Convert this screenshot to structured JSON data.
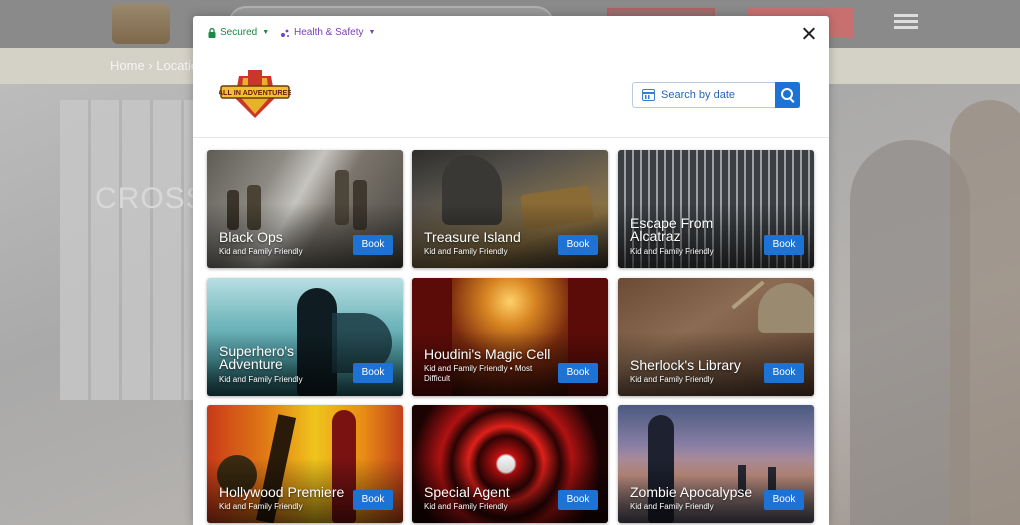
{
  "background": {
    "breadcrumb": "Home › Locatio",
    "hero_text": "CROSS"
  },
  "modal": {
    "secured_label": "Secured",
    "health_label": "Health & Safety",
    "search": {
      "placeholder": "Search by date"
    },
    "brand": {
      "logo_text": "ALL IN ADVENTURES"
    },
    "book_label": "Book",
    "rooms": [
      {
        "title": "Black Ops",
        "subtitle": "Kid and Family Friendly"
      },
      {
        "title": "Treasure Island",
        "subtitle": "Kid and Family Friendly"
      },
      {
        "title": "Escape From Alcatraz",
        "subtitle": "Kid and Family Friendly"
      },
      {
        "title": "Superhero's Adventure",
        "subtitle": "Kid and Family Friendly"
      },
      {
        "title": "Houdini's Magic Cell",
        "subtitle": "Kid and Family Friendly • Most Difficult"
      },
      {
        "title": "Sherlock's Library",
        "subtitle": "Kid and Family Friendly"
      },
      {
        "title": "Hollywood Premiere",
        "subtitle": "Kid and Family Friendly"
      },
      {
        "title": "Special Agent",
        "subtitle": "Kid and Family Friendly"
      },
      {
        "title": "Zombie Apocalypse",
        "subtitle": "Kid and Family Friendly"
      }
    ]
  },
  "colors": {
    "accent": "#1d72d6",
    "secured": "#1a8a43",
    "health": "#7a3fb8"
  }
}
